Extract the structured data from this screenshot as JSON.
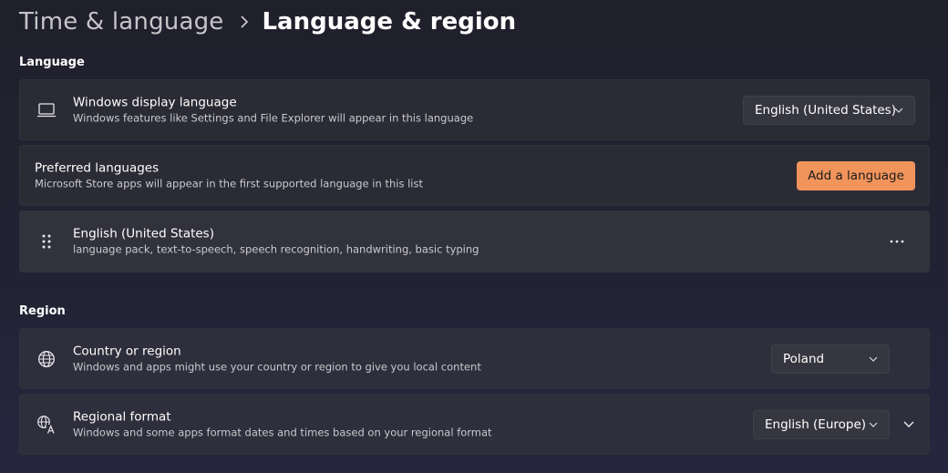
{
  "breadcrumb": {
    "parent": "Time & language",
    "current": "Language & region"
  },
  "sections": {
    "language": "Language",
    "region": "Region"
  },
  "display_language": {
    "title": "Windows display language",
    "description": "Windows features like Settings and File Explorer will appear in this language",
    "icon": "laptop-icon",
    "selected": "English (United States)"
  },
  "preferred_languages": {
    "title": "Preferred languages",
    "description": "Microsoft Store apps will appear in the first supported language in this list",
    "button": "Add a language"
  },
  "installed_language": {
    "title": "English (United States)",
    "description": "language pack, text-to-speech, speech recognition, handwriting, basic typing",
    "icon": "drag-handle-icon"
  },
  "country_region": {
    "title": "Country or region",
    "description": "Windows and apps might use your country or region to give you local content",
    "icon": "globe-icon",
    "selected": "Poland"
  },
  "regional_format": {
    "title": "Regional format",
    "description": "Windows and some apps format dates and times based on your regional format",
    "icon": "regional-format-icon",
    "selected": "English (Europe)"
  },
  "colors": {
    "accent": "#f0945b",
    "card": "#2b2b35",
    "text_secondary": "#c9c9ce"
  }
}
